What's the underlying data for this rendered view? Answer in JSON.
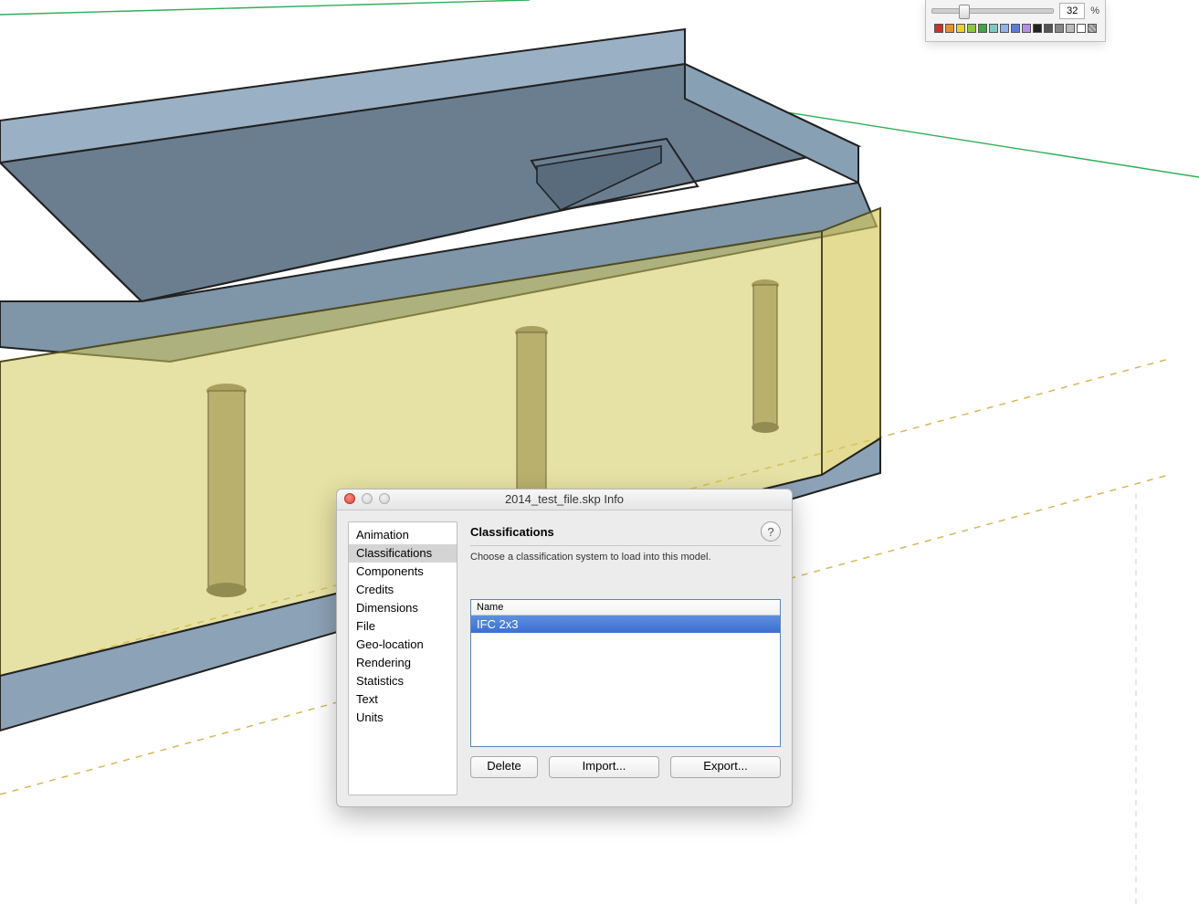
{
  "palette": {
    "opacity_value": "32",
    "opacity_unit": "%",
    "swatches": [
      "#C6342B",
      "#E8912B",
      "#E8D22B",
      "#8FC63F",
      "#3FA548",
      "#7FC9C3",
      "#8FB4E8",
      "#5B7BD6",
      "#B48FE8",
      "#222222",
      "#555555",
      "#888888",
      "#BBBBBB",
      "#FFFFFF",
      "tex"
    ]
  },
  "dialog": {
    "title": "2014_test_file.skp Info",
    "sidebar": [
      "Animation",
      "Classifications",
      "Components",
      "Credits",
      "Dimensions",
      "File",
      "Geo-location",
      "Rendering",
      "Statistics",
      "Text",
      "Units"
    ],
    "selected_index": 1,
    "panel": {
      "title": "Classifications",
      "description": "Choose a classification system to load into this model.",
      "list_header": "Name",
      "rows": [
        "IFC 2x3"
      ],
      "buttons": {
        "delete": "Delete",
        "import": "Import...",
        "export": "Export..."
      }
    }
  }
}
